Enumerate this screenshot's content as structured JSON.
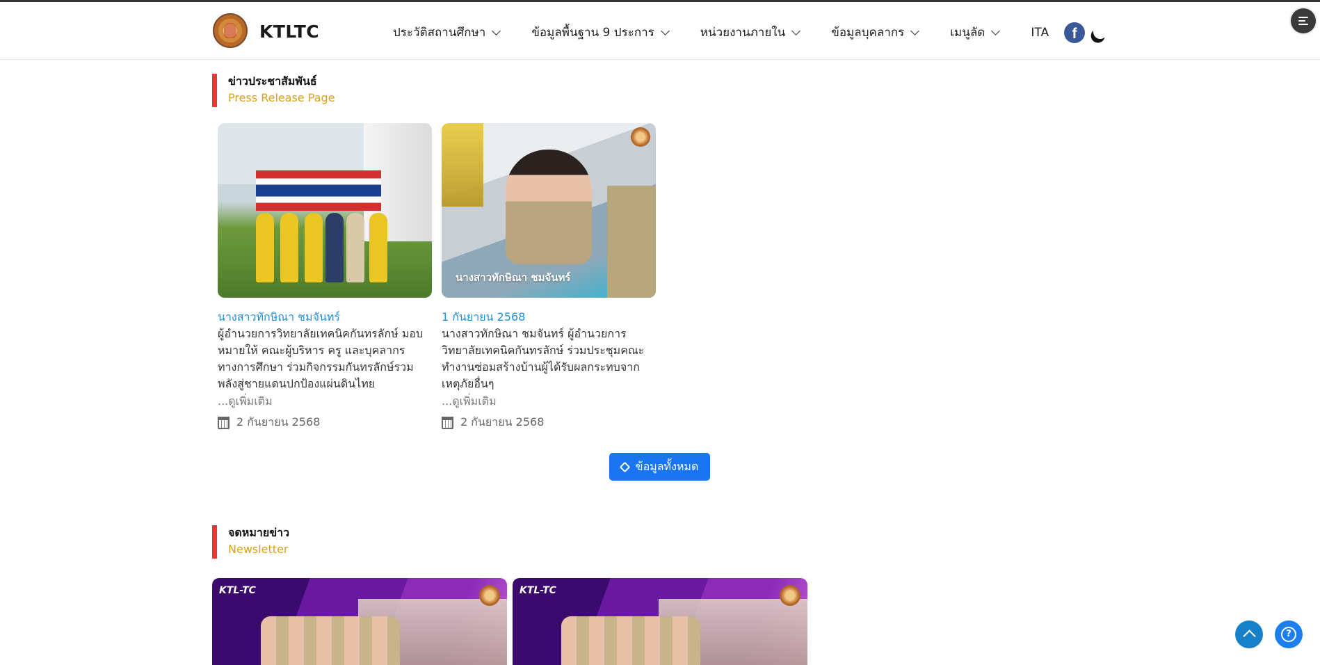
{
  "header": {
    "brand": "KTLTC",
    "nav": [
      {
        "label": "ประวัติสถานศึกษา",
        "dropdown": true
      },
      {
        "label": "ข้อมูลพื้นฐาน 9 ประการ",
        "dropdown": true
      },
      {
        "label": "หน่วยงานภายใน",
        "dropdown": true
      },
      {
        "label": "ข้อมูลบุคลากร",
        "dropdown": true
      },
      {
        "label": "เมนูลัด",
        "dropdown": true
      },
      {
        "label": "ITA",
        "dropdown": false
      }
    ],
    "facebook_glyph": "f"
  },
  "press": {
    "title_th": "ข่าวประชาสัมพันธ์",
    "title_en": "Press Release Page",
    "cards": [
      {
        "title": "นางสาวทักษิณา ชมจันทร์",
        "desc": "ผู้อำนวยการวิทยาลัยเทคนิคกันทรลักษ์ มอบหมายให้ คณะผู้บริหาร ครู และบุคลากรทางการศึกษา ร่วมกิจกรรมกันทรลักษ์รวมพลังสู่ชายแดนปกป้องแผ่นดินไทย",
        "more": "...ดูเพิ่มเติม",
        "date": "2 กันยายน 2568"
      },
      {
        "title": "1 กันยายน 2568",
        "desc": "นางสาวทักษิณา ชมจันทร์ ผู้อำนวยการวิทยาลัยเทคนิคกันทรลักษ์ ร่วมประชุมคณะทำงานซ่อมสร้างบ้านผู้ได้รับผลกระทบจากเหตุภัยอื่นๆ",
        "more": "...ดูเพิ่มเติม",
        "date": "2 กันยายน 2568",
        "image_caption": "นางสาวทักษิณา ชมจันทร์"
      }
    ],
    "all_button": "ข้อมูลทั้งหมด"
  },
  "newsletter": {
    "title_th": "จดหมายข่าว",
    "title_en": "Newsletter",
    "items": [
      {
        "tag": "KTL-TC"
      },
      {
        "tag": "KTL-TC"
      }
    ]
  },
  "colors": {
    "accent_red": "#e53935",
    "accent_gold": "#d9a21b",
    "link_blue": "#1f8fd6",
    "button_blue": "#1976f0"
  }
}
